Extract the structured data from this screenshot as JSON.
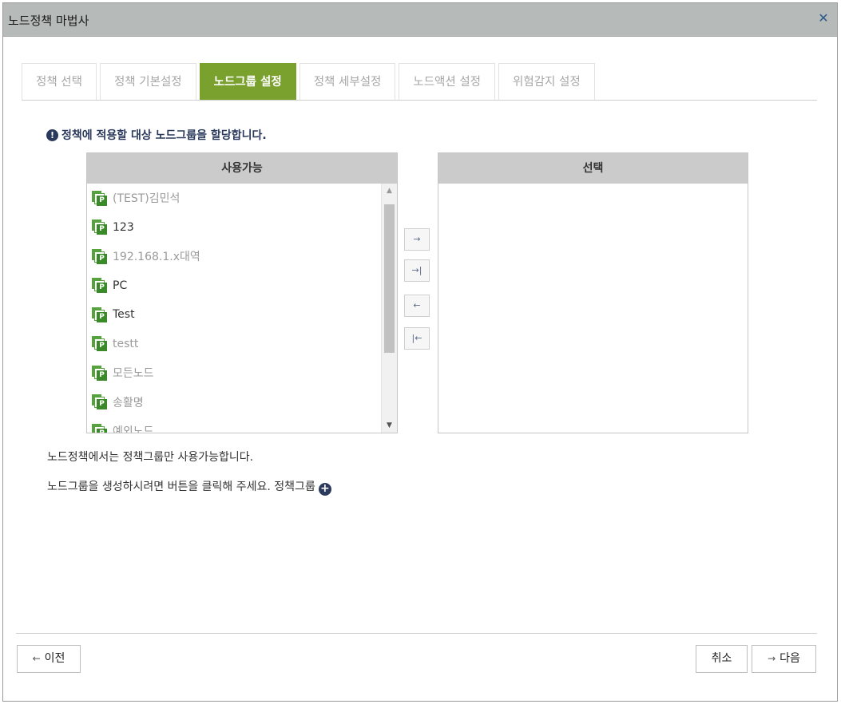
{
  "window": {
    "title": "노드정책 마법사",
    "close_icon": "close-icon"
  },
  "tabs": [
    {
      "label": "정책 선택",
      "active": false
    },
    {
      "label": "정책 기본설정",
      "active": false
    },
    {
      "label": "노드그룹 설정",
      "active": true
    },
    {
      "label": "정책 세부설정",
      "active": false
    },
    {
      "label": "노드액션 설정",
      "active": false
    },
    {
      "label": "위험감지 설정",
      "active": false
    }
  ],
  "notice": {
    "icon": "info-icon",
    "text": "정책에 적용할 대상 노드그룹을 할당합니다."
  },
  "available": {
    "header": "사용가능",
    "items": [
      {
        "label": "(TEST)김민석",
        "icon_badge": "P",
        "muted": true
      },
      {
        "label": "123",
        "icon_badge": "P",
        "muted": false
      },
      {
        "label": "192.168.1.x대역",
        "icon_badge": "P",
        "muted": true
      },
      {
        "label": "PC",
        "icon_badge": "P",
        "muted": false
      },
      {
        "label": "Test",
        "icon_badge": "P",
        "muted": false
      },
      {
        "label": "testt",
        "icon_badge": "P",
        "muted": true
      },
      {
        "label": "모든노드",
        "icon_badge": "P",
        "muted": true
      },
      {
        "label": "송활명",
        "icon_badge": "P",
        "muted": true
      },
      {
        "label": "예외노드",
        "icon_badge": "P",
        "muted": true
      }
    ]
  },
  "selected": {
    "header": "선택",
    "items": []
  },
  "move_buttons": {
    "add": "→",
    "add_all": "→|",
    "remove": "←",
    "remove_all": "|←"
  },
  "info": {
    "line1": "노드정책에서는 정책그룹만 사용가능합니다.",
    "line2": "노드그룹을 생성하시려면 버튼을 클릭해 주세요. 정책그룹",
    "add_icon": "+"
  },
  "footer": {
    "prev_arrow": "←",
    "prev_label": "이전",
    "cancel_label": "취소",
    "next_arrow": "→",
    "next_label": "다음"
  },
  "colors": {
    "active_tab": "#7aa12e",
    "title_bar": "#b6bab8",
    "group_icon": "#56a23d",
    "notice_text": "#2b3a5c"
  }
}
